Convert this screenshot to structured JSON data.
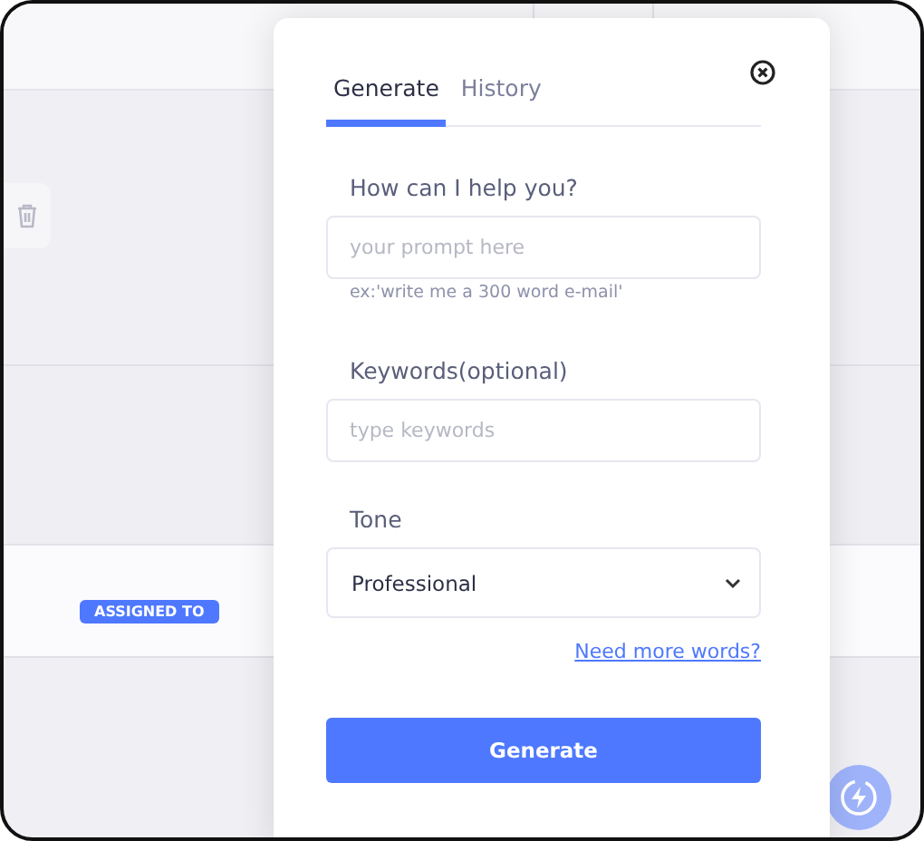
{
  "background": {
    "badge": "ASSIGNED TO"
  },
  "panel": {
    "tabs": [
      {
        "label": "Generate",
        "selected": true
      },
      {
        "label": "History",
        "selected": false
      }
    ],
    "prompt": {
      "label": "How can I help you?",
      "placeholder": "your prompt here",
      "hint": "ex:'write me a 300 word e-mail'"
    },
    "keywords": {
      "label": "Keywords(optional)",
      "placeholder": "type keywords"
    },
    "tone": {
      "label": "Tone",
      "value": "Professional"
    },
    "link": "Need more words?",
    "button": "Generate"
  }
}
